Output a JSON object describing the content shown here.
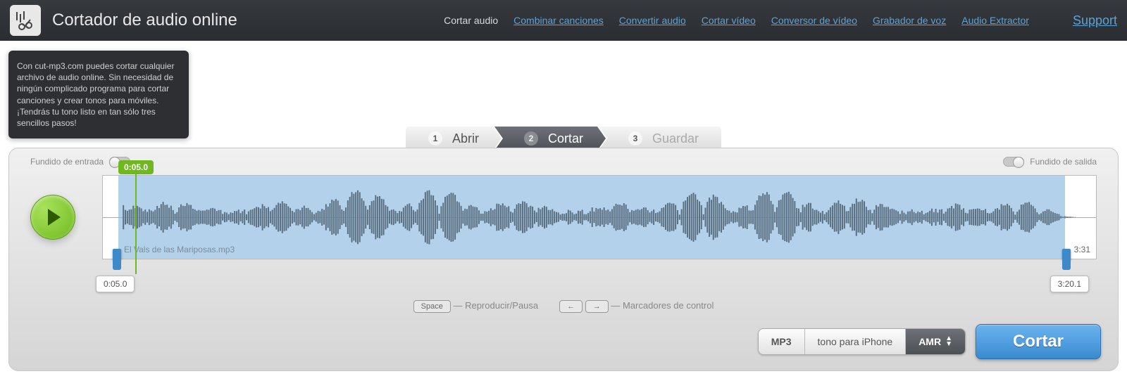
{
  "header": {
    "app_title": "Cortador de audio online"
  },
  "nav": {
    "items": [
      {
        "label": "Cortar audio",
        "active": true
      },
      {
        "label": "Combinar canciones",
        "active": false
      },
      {
        "label": "Convertir audio",
        "active": false
      },
      {
        "label": "Cortar vídeo",
        "active": false
      },
      {
        "label": "Conversor de vídeo",
        "active": false
      },
      {
        "label": "Grabador de voz",
        "active": false
      },
      {
        "label": "Audio Extractor",
        "active": false
      }
    ],
    "support": "Support"
  },
  "info_box": "Con cut-mp3.com puedes cortar cualquier archivo de audio online. Sin necesidad de ningún complicado programa para cortar canciones y crear tonos para móviles. ¡Tendrás tu tono listo en tan sólo tres sencillos pasos!",
  "steps": {
    "s1_num": "1",
    "s1_label": "Abrir",
    "s2_num": "2",
    "s2_label": "Cortar",
    "s3_num": "3",
    "s3_label": "Guardar"
  },
  "editor": {
    "fade_in_label": "Fundido de entrada",
    "fade_out_label": "Fundido de salida",
    "playhead_time": "0:05.0",
    "range_start": "0:05.0",
    "range_end": "3:20.1",
    "filename": "El Vals de las Mariposas.mp3",
    "total_duration": "3:31"
  },
  "hints": {
    "space_key": "Space",
    "space_label": "— Reproducir/Pausa",
    "arrows_left": "←",
    "arrows_right": "→",
    "arrows_label": "— Marcadores de control"
  },
  "actions": {
    "mp3": "MP3",
    "iphone": "tono para iPhone",
    "amr": "AMR",
    "cut": "Cortar"
  }
}
